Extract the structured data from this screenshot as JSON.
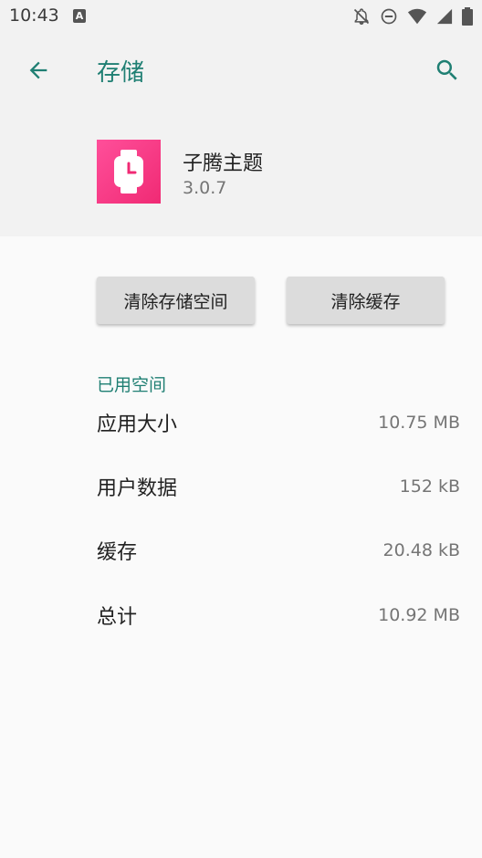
{
  "status_bar": {
    "time": "10:43",
    "notification_icon": "A"
  },
  "toolbar": {
    "title": "存储",
    "back_icon": "arrow-left-icon",
    "search_icon": "search-icon",
    "accent_color": "#1f7f73"
  },
  "app": {
    "name": "子腾主题",
    "version": "3.0.7",
    "icon_color": "#f02a74"
  },
  "buttons": {
    "clear_storage": "清除存储空间",
    "clear_cache": "清除缓存"
  },
  "storage": {
    "section_title": "已用空间",
    "rows": [
      {
        "label": "应用大小",
        "value": "10.75 MB"
      },
      {
        "label": "用户数据",
        "value": "152 kB"
      },
      {
        "label": "缓存",
        "value": "20.48 kB"
      },
      {
        "label": "总计",
        "value": "10.92 MB"
      }
    ]
  }
}
